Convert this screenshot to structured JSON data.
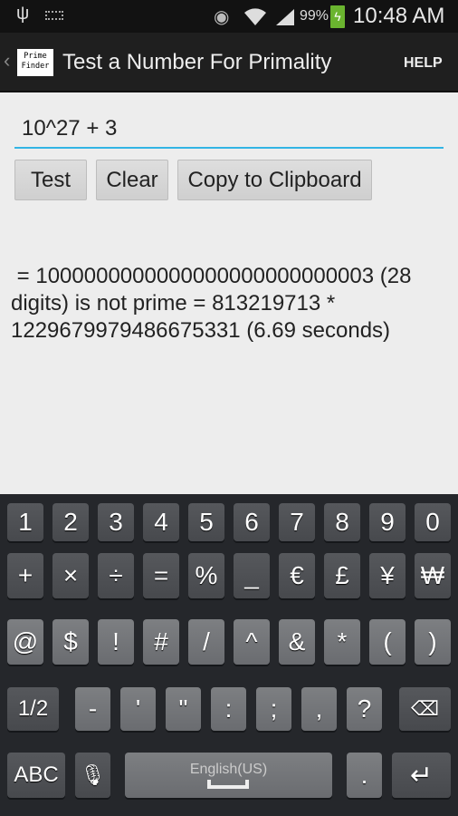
{
  "status_bar": {
    "battery": "99%",
    "time": "10:48 AM",
    "icons": [
      "usb-icon",
      "keyboard-icon",
      "eye-icon",
      "wifi-icon",
      "signal-icon",
      "battery-charging-icon"
    ]
  },
  "action_bar": {
    "logo_line1": "Prime",
    "logo_line2": "Finder",
    "title": "Test a Number For Primality",
    "help": "HELP"
  },
  "input": {
    "value": "10^27 + 3"
  },
  "buttons": {
    "test": "Test",
    "clear": "Clear",
    "copy": "Copy to Clipboard"
  },
  "result": {
    "line1": " = 1000000000000000000000000003 (28",
    "line2": "digits) is not prime = 813219713 *",
    "line3": "1229679979486675331 (6.69 seconds)"
  },
  "keyboard": {
    "row1": [
      "1",
      "2",
      "3",
      "4",
      "5",
      "6",
      "7",
      "8",
      "9",
      "0"
    ],
    "row2": [
      "+",
      "×",
      "÷",
      "=",
      "%",
      "_",
      "€",
      "£",
      "¥",
      "₩"
    ],
    "row3": [
      "@",
      "$",
      "!",
      "#",
      "/",
      "^",
      "&",
      "*",
      "(",
      ")"
    ],
    "row4": {
      "page": "1/2",
      "keys": [
        "-",
        "'",
        "\"",
        ":",
        ";",
        ",",
        "?"
      ]
    },
    "row5": {
      "abc": "ABC",
      "space_label": "English(US)",
      "period": "."
    },
    "colors": {
      "background": "#25272b",
      "accent": "#33b5e5"
    }
  }
}
